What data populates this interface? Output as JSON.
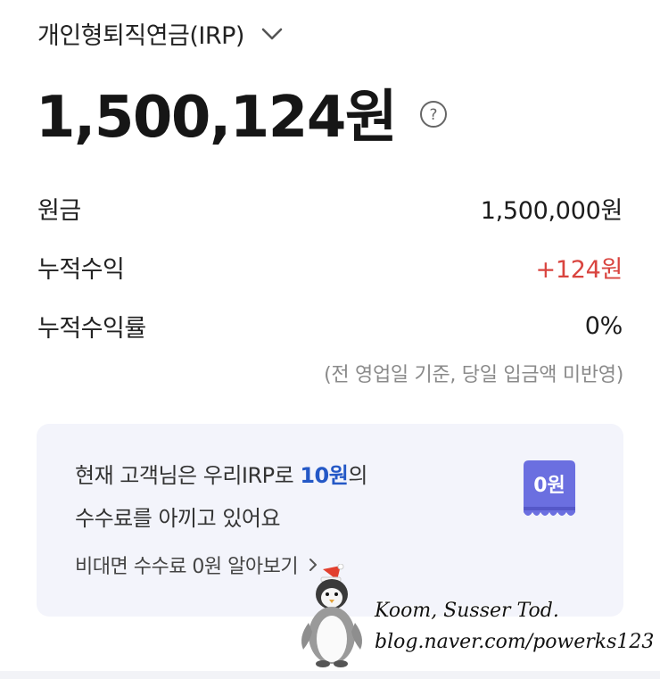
{
  "account": {
    "name": "개인형퇴직연금(IRP)",
    "chevron_icon": "chevron-down-icon"
  },
  "balance": {
    "amount": "1,500,124원",
    "help_icon": "question-circle-icon"
  },
  "summary": {
    "principal_label": "원금",
    "principal_value": "1,500,000원",
    "profit_label": "누적수익",
    "profit_value": "+124원",
    "rate_label": "누적수익률",
    "rate_value": "0%"
  },
  "footnote": "(전 영업일 기준, 당일 입금액 미반영)",
  "fee_card": {
    "line1_prefix": "현재 고객님은 우리IRP로 ",
    "line1_amount": "10원",
    "line1_suffix": "의",
    "line2": "수수료를 아끼고 있어요",
    "link_label": "비대면 수수료 0원 알아보기",
    "ticket_label": "0원"
  },
  "watermark": {
    "line1": "Koom, Susser Tod.",
    "line2": "blog.naver.com/powerks123"
  },
  "colors": {
    "profit": "#d9443f",
    "accent_blue": "#2458c6",
    "ticket": "#6b6fe0",
    "card_bg": "#f3f4fb"
  }
}
